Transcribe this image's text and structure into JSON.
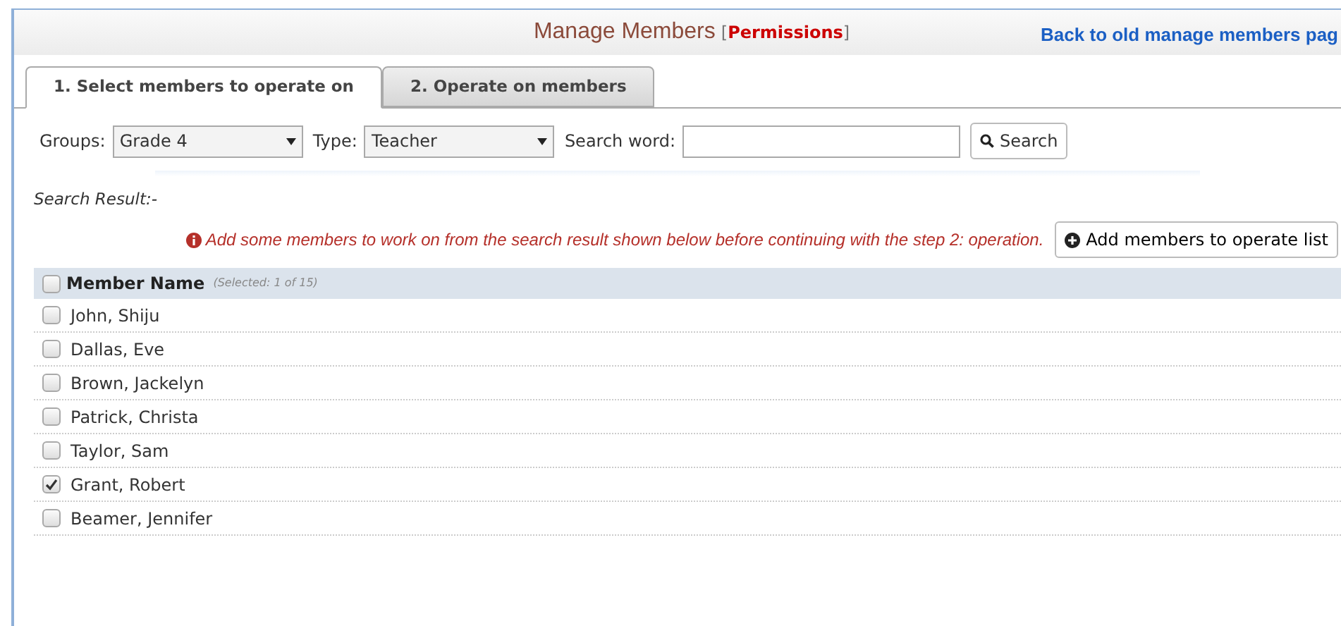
{
  "header": {
    "title": "Manage Members",
    "bracket_open": "[",
    "permissions_link": "Permissions",
    "bracket_close": "]",
    "back_link": "Back to old manage members pag"
  },
  "tabs": [
    {
      "label": "1. Select members to operate on",
      "selected": true
    },
    {
      "label": "2. Operate on members",
      "selected": false
    }
  ],
  "filters": {
    "groups_label": "Groups:",
    "groups_value": "Grade 4",
    "type_label": "Type:",
    "type_value": "Teacher",
    "search_label": "Search word:",
    "search_button": "Search"
  },
  "search_result_label": "Search Result:-",
  "message": "Add some members to work on from the search result shown below before continuing with the step 2: operation.",
  "add_button": "Add members to operate list",
  "table": {
    "column": "Member Name",
    "selected_count": "(Selected: 1 of 15)",
    "all_checked": false,
    "rows": [
      {
        "name": "John, Shiju",
        "checked": false
      },
      {
        "name": "Dallas, Eve",
        "checked": false
      },
      {
        "name": "Brown, Jackelyn",
        "checked": false
      },
      {
        "name": "Patrick, Christa",
        "checked": false
      },
      {
        "name": "Taylor, Sam",
        "checked": false
      },
      {
        "name": "Grant, Robert",
        "checked": true
      },
      {
        "name": "Beamer, Jennifer",
        "checked": false
      }
    ]
  }
}
